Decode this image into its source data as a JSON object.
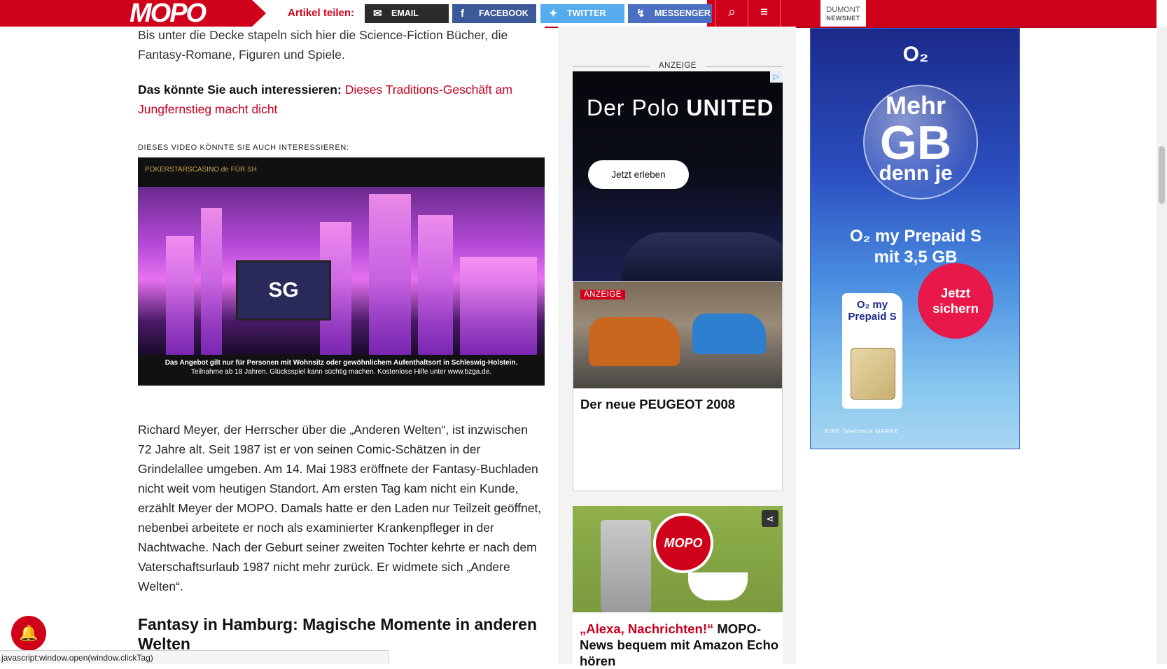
{
  "header": {
    "logo": "MOPO",
    "share_label": "Artikel teilen:",
    "buttons": [
      {
        "label": "EMAIL",
        "icon": "envelope-icon"
      },
      {
        "label": "FACEBOOK",
        "icon": "facebook-icon"
      },
      {
        "label": "TWITTER",
        "icon": "twitter-icon"
      },
      {
        "label": "MESSENGER",
        "icon": "messenger-icon"
      }
    ],
    "dumont_line1": "DUMONT",
    "dumont_line2": "NEWSNET",
    "brand_color": "#d0021b"
  },
  "article": {
    "intro_fragment": "Bis unter die Decke stapeln sich hier die Science-Fiction Bücher, die Fantasy-Romane, Figuren und Spiele.",
    "also_interesting_label": "Das könnte Sie auch interessieren:",
    "also_interesting_link": "Dieses Traditions-Geschäft am Jungfernstieg macht dicht",
    "video_label": "DIESES VIDEO KÖNNTE SIE AUCH INTERESSIEREN:",
    "video": {
      "brand": "POKERSTARSCASINO.de FÜR SH",
      "screen_text": "SG",
      "caption_line1": "Das Angebot gilt nur für Personen mit Wohnsitz oder gewöhnlichem Aufenthaltsort in Schleswig-Holstein.",
      "caption_line2": "Teilnahme ab 18 Jahren. Glücksspiel kann süchtig machen. Kostenlose Hilfe unter www.bzga.de."
    },
    "paragraph": "Richard Meyer, der Herrscher über die „Anderen Welten“, ist inzwischen 72 Jahre alt. Seit 1987 ist er von seinen Comic-Schätzen in der Grindelallee umgeben. Am 14. Mai 1983 eröffnete der Fantasy-Buchladen nicht weit vom heutigen Standort. Am ersten Tag kam nicht ein Kunde, erzählt Meyer der MOPO. Damals hatte er den Laden nur Teilzeit geöffnet, nebenbei arbeitete er noch als examinierter Krankenpfleger in der Nachtwache. Nach der Geburt seiner zweiten Tochter kehrte er nach dem Vaterschaftsurlaub 1987 nicht mehr zurück. Er widmete sich „Andere Welten“.",
    "subheading": "Fantasy in Hamburg: Magische Momente in anderen Welten"
  },
  "sidebar": {
    "anzeige": "ANZEIGE",
    "polo": {
      "title_light": "Der Polo ",
      "title_bold": "UNITED",
      "cta": "Jetzt erleben"
    },
    "peugeot": {
      "tag": "ANZEIGE",
      "title": "Der neue PEUGEOT 2008"
    },
    "alexa": {
      "bubble": "MOPO",
      "headline_red": "„Alexa, Nachrichten!“",
      "headline_rest": " MOPO-News bequem mit Amazon Echo hören"
    }
  },
  "o2_ad": {
    "logo": "O₂",
    "line1": "Mehr",
    "line2": "GB",
    "line3": "denn je",
    "plan_line1": "O₂ my Prepaid S",
    "plan_line2": "mit 3,5 GB",
    "sim_label": "O₂ my Prepaid S",
    "cta": "Jetzt sichern",
    "footer": "EINE Telefónica MARKE"
  },
  "status": {
    "url": "javascript:window.open(window.clickTag)"
  }
}
